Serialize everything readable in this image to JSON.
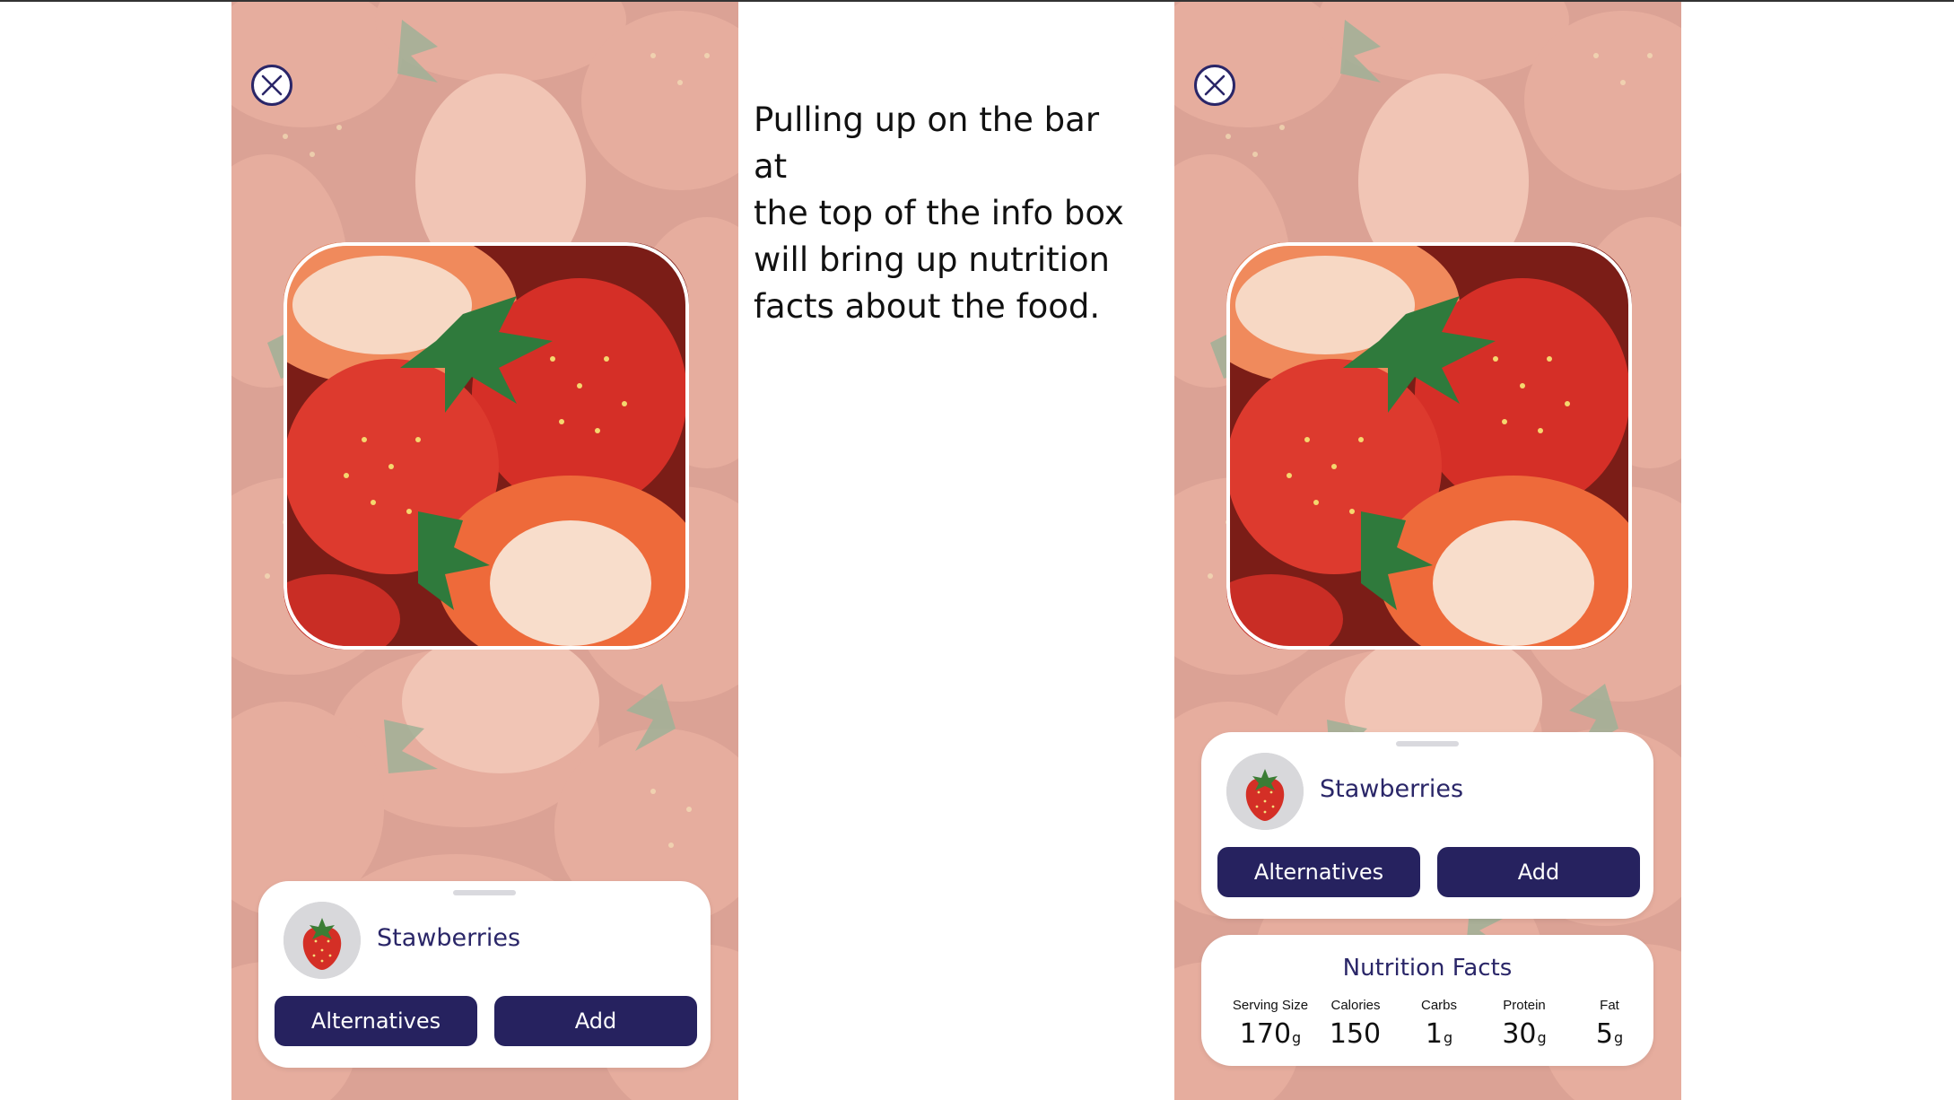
{
  "caption": {
    "line1": "Pulling up on the bar at",
    "line2": "the top of the info box",
    "line3": "will bring up nutrition",
    "line4": "facts about the food."
  },
  "left_screen": {
    "close_icon": "close-x-icon",
    "food_name": "Stawberries",
    "alternatives_label": "Alternatives",
    "add_label": "Add"
  },
  "right_screen": {
    "close_icon": "close-x-icon",
    "food_name": "Stawberries",
    "alternatives_label": "Alternatives",
    "add_label": "Add",
    "nutrition": {
      "title": "Nutrition Facts",
      "items": [
        {
          "label": "Serving Size",
          "value": "170",
          "unit": "g"
        },
        {
          "label": "Calories",
          "value": "150",
          "unit": ""
        },
        {
          "label": "Carbs",
          "value": "1",
          "unit": "g"
        },
        {
          "label": "Protein",
          "value": "30",
          "unit": "g"
        },
        {
          "label": "Fat",
          "value": "5",
          "unit": "g"
        }
      ]
    }
  },
  "colors": {
    "brand_navy": "#26225f",
    "text_navy": "#2a2668",
    "strawberry_red": "#d42f26"
  }
}
